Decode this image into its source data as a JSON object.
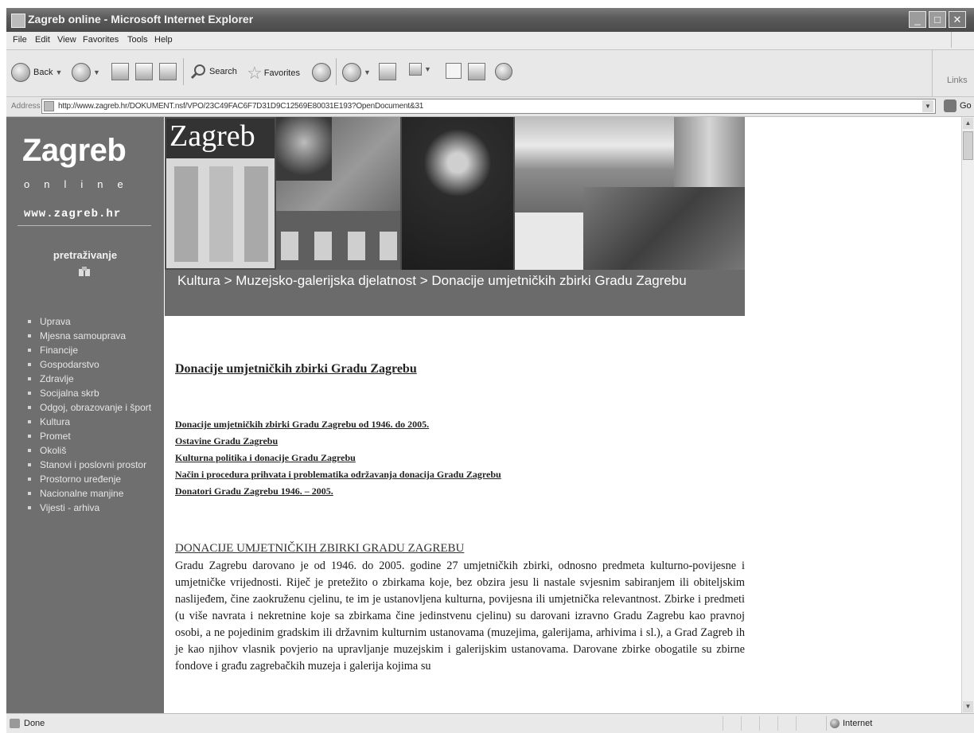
{
  "window": {
    "title": "Zagreb online - Microsoft Internet Explorer",
    "controls": {
      "minimize": "_",
      "maximize": "□",
      "close": "✕"
    }
  },
  "menu": [
    "File",
    "Edit",
    "View",
    "Favorites",
    "Tools",
    "Help"
  ],
  "toolbar": {
    "back": "Back",
    "search": "Search",
    "favorites": "Favorites",
    "links": "Links"
  },
  "address": {
    "label": "Address",
    "url": "http://www.zagreb.hr/DOKUMENT.nsf/VPO/23C49FAC6F7D31D9C12569E80031E193?OpenDocument&31",
    "go": "Go"
  },
  "sidebar": {
    "logo": "Zagreb",
    "subtitle": "online",
    "site": "www.zagreb.hr",
    "search_label": "pretraživanje",
    "items": [
      "Uprava",
      "Mjesna samouprava",
      "Financije",
      "Gospodarstvo",
      "Zdravlje",
      "Socijalna skrb",
      "Odgoj, obrazovanje i šport",
      "Kultura",
      "Promet",
      "Okoliš",
      "Stanovi i poslovni prostor",
      "Prostorno uređenje",
      "Nacionalne manjine",
      "Vijesti - arhiva"
    ]
  },
  "banner": {
    "logo_text": "Zagreb",
    "colors": {
      "dark": "#3c3c3c",
      "mid": "#6b6b6b",
      "light": "#b5b5b5"
    }
  },
  "breadcrumb": "Kultura > Muzejsko-galerijska djelatnost > Donacije umjetničkih zbirki Gradu Zagrebu",
  "main": {
    "heading": "Donacije umjetničkih zbirki Gradu Zagrebu",
    "links": [
      "Donacije umjetničkih zbirki Gradu Zagrebu od 1946. do 2005.",
      "Ostavine Gradu Zagrebu",
      "Kulturna politika i donacije Gradu Zagrebu",
      "Način i procedura prihvata i problematika održavanja donacija Gradu Zagrebu",
      "Donatori Gradu Zagrebu 1946. – 2005."
    ],
    "section_title": "DONACIJE UMJETNIČKIH ZBIRKI GRADU ZAGREBU",
    "paragraph": "Gradu Zagrebu darovano je od 1946. do 2005. godine 27 umjetničkih zbirki, odnosno predmeta kulturno-povijesne i umjetničke vrijednosti. Riječ je pretežito o zbirkama koje, bez obzira jesu li nastale svjesnim sabiranjem ili obiteljskim naslijeđem, čine zaokruženu cjelinu, te im je ustanovljena kulturna, povijesna ili umjetnička relevantnost. Zbirke i predmeti (u više navrata i nekretnine koje sa zbirkama čine jedinstvenu cjelinu) su darovani izravno Gradu Zagrebu kao pravnoj osobi, a ne pojedinim gradskim ili državnim kulturnim ustanovama (muzejima, galerijama, arhivima i sl.), a Grad Zagreb ih je kao njihov vlasnik povjerio na upravljanje muzejskim i galerijskim ustanovama. Darovane zbirke obogatile su zbirne fondove i građu zagrebačkih muzeja i galerija kojima su"
  },
  "status": {
    "text": "Done",
    "zone": "Internet"
  }
}
